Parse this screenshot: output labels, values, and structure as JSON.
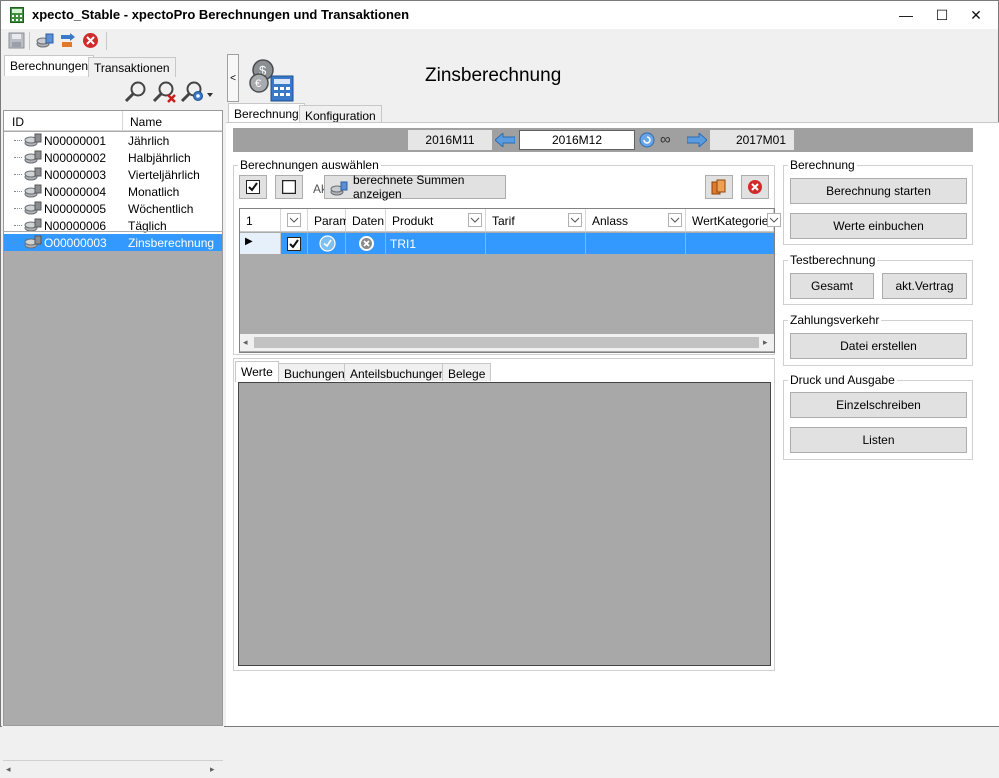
{
  "window": {
    "title": "xpecto_Stable - xpectoPro Berechnungen und Transaktionen",
    "minimize": "—",
    "maximize": "☐",
    "close": "✕"
  },
  "left": {
    "tabs": [
      "Berechnungen",
      "Transaktionen"
    ],
    "columns": [
      "ID",
      "Name"
    ],
    "rows": [
      {
        "id": "N00000001",
        "name": "Jährlich"
      },
      {
        "id": "N00000002",
        "name": "Halbjährlich"
      },
      {
        "id": "N00000003",
        "name": "Vierteljährlich"
      },
      {
        "id": "N00000004",
        "name": "Monatlich"
      },
      {
        "id": "N00000005",
        "name": "Wöchentlich"
      },
      {
        "id": "N00000006",
        "name": "Täglich"
      },
      {
        "id": "O00000003",
        "name": "Zinsberechnung"
      }
    ],
    "selected_row": 6
  },
  "main": {
    "collapse_glyph": "<",
    "title": "Zinsberechnung",
    "tabs": [
      "Berechnung",
      "Konfiguration"
    ],
    "period": {
      "prev": "2016M11",
      "current": "2016M12",
      "next": "2017M01",
      "infinity": "∞"
    },
    "select_group": {
      "legend": "Berechnungen auswählen",
      "partial_label": "Ak",
      "sums_button": "berechnete Summen anzeigen"
    },
    "grid": {
      "row_count": "1",
      "columns": [
        "Param",
        "Daten",
        "Produkt",
        "Tarif",
        "Anlass",
        "WertKategorie"
      ],
      "row": {
        "produkt": "TRI1"
      }
    },
    "bottom_tabs": [
      "Werte",
      "Buchungen",
      "Anteilsbuchungen",
      "Belege"
    ]
  },
  "side": {
    "berechnung": {
      "legend": "Berechnung",
      "start": "Berechnung starten",
      "book": "Werte einbuchen"
    },
    "test": {
      "legend": "Testberechnung",
      "total": "Gesamt",
      "contract": "akt.Vertrag"
    },
    "payment": {
      "legend": "Zahlungsverkehr",
      "file": "Datei erstellen"
    },
    "print": {
      "legend": "Druck und Ausgabe",
      "single": "Einzelschreiben",
      "lists": "Listen"
    }
  }
}
